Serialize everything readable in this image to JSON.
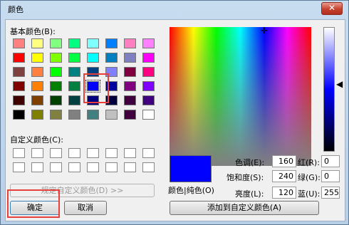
{
  "window": {
    "title": "颜色",
    "close_glyph": "✕"
  },
  "labels": {
    "basic": "基本颜色(B):",
    "custom": "自定义颜色(C):",
    "color_solid": "颜色|纯色(O)",
    "hue": "色调(E):",
    "sat": "饱和度(S):",
    "lum": "亮度(L):",
    "red": "红(R):",
    "green": "绿(G):",
    "blue": "蓝(U):"
  },
  "values": {
    "hue": "160",
    "sat": "240",
    "lum": "120",
    "red": "0",
    "green": "0",
    "blue": "255"
  },
  "buttons": {
    "define": "规定自定义颜色(D) >>",
    "ok": "确定",
    "cancel": "取消",
    "add": "添加到自定义颜色(A)"
  },
  "colors": {
    "basic": [
      [
        "#ff8080",
        "#ffff80",
        "#80ff80",
        "#00ff80",
        "#80ffff",
        "#0080ff",
        "#ff80c0",
        "#ff80ff"
      ],
      [
        "#ff0000",
        "#ffff00",
        "#80ff00",
        "#00ff40",
        "#00ffff",
        "#0080c0",
        "#8080c0",
        "#ff00ff"
      ],
      [
        "#804040",
        "#ff8040",
        "#00ff00",
        "#008080",
        "#004080",
        "#8080ff",
        "#800040",
        "#ff0080"
      ],
      [
        "#800000",
        "#ff8000",
        "#008000",
        "#008040",
        "#0000ff",
        "#0000a0",
        "#800080",
        "#8000ff"
      ],
      [
        "#400000",
        "#804000",
        "#004000",
        "#004040",
        "#000080",
        "#000040",
        "#400040",
        "#400080"
      ],
      [
        "#000000",
        "#808000",
        "#808040",
        "#808080",
        "#408080",
        "#c0c0c0",
        "#400040",
        "#ffffff"
      ]
    ],
    "selected": "#0000ff"
  }
}
